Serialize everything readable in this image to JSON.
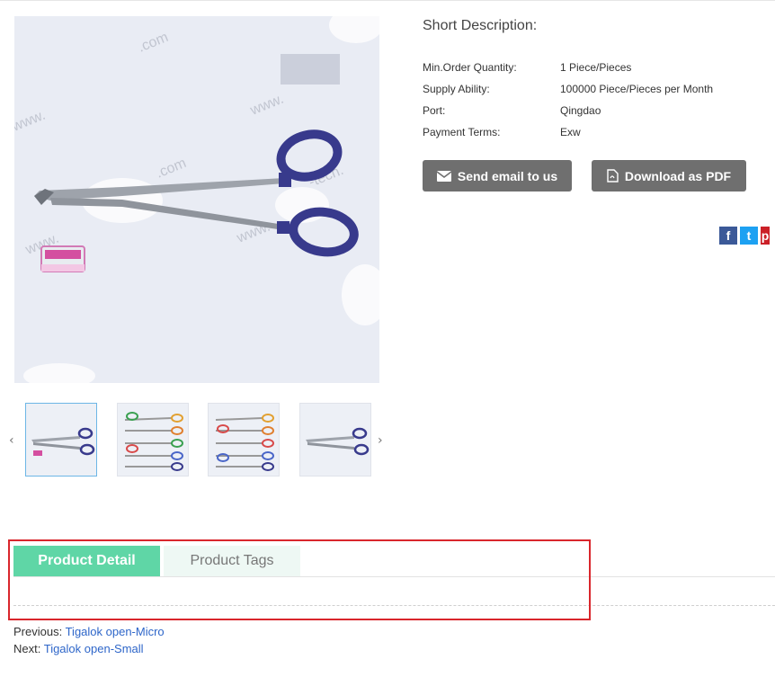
{
  "product": {
    "short_description_label": "Short Description:",
    "specs": [
      {
        "key": "Min.Order Quantity:",
        "value": "1 Piece/Pieces"
      },
      {
        "key": "Supply Ability:",
        "value": "100000 Piece/Pieces per Month"
      },
      {
        "key": "Port:",
        "value": "Qingdao"
      },
      {
        "key": "Payment Terms:",
        "value": "Exw"
      }
    ],
    "buttons": {
      "email": "Send email to us",
      "pdf": "Download as PDF"
    }
  },
  "gallery": {
    "prev_arrow": "‹",
    "next_arrow": "›",
    "thumbnails": [
      "thumb-1",
      "thumb-2",
      "thumb-3",
      "thumb-4"
    ],
    "watermark": "www.          .com"
  },
  "social": {
    "facebook": "f",
    "twitter": "t",
    "pinterest": "p"
  },
  "tabs": {
    "detail": "Product Detail",
    "tags": "Product Tags"
  },
  "navigation": {
    "previous_label": "Previous:",
    "previous_link": "Tigalok open-Micro",
    "next_label": "Next:",
    "next_link": "Tigalok open-Small"
  },
  "colors": {
    "tab_active": "#5fd6a6",
    "button_bg": "#6f6f6f",
    "highlight_border": "#d9262c",
    "link": "#2e66c9"
  }
}
